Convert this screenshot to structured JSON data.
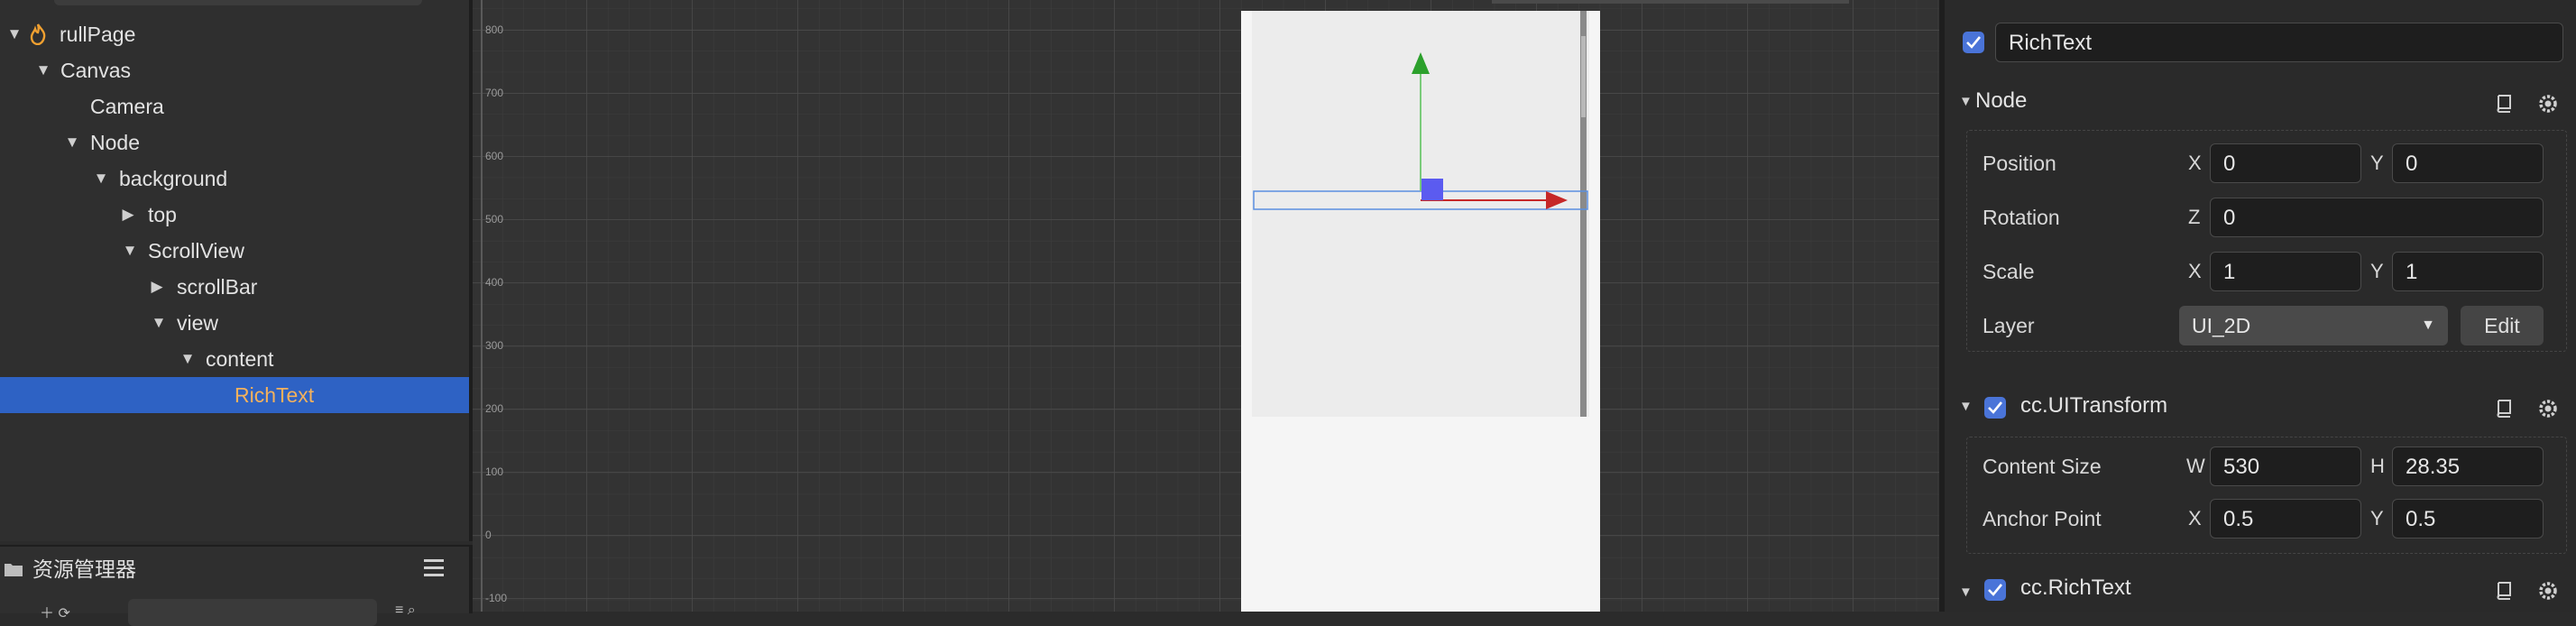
{
  "hierarchy": {
    "root": "rullPage",
    "nodes": {
      "canvas": "Canvas",
      "camera": "Camera",
      "node": "Node",
      "background": "background",
      "top": "top",
      "scrollview": "ScrollView",
      "scrollbar": "scrollBar",
      "view": "view",
      "content": "content",
      "richtext": "RichText"
    }
  },
  "assets": {
    "title": "资源管理器"
  },
  "scene": {
    "ruler_labels": [
      "800",
      "700",
      "600",
      "500",
      "400",
      "300",
      "200",
      "100",
      "0",
      "-100"
    ]
  },
  "inspector": {
    "node_name": "RichText",
    "node_section": {
      "title": "Node",
      "position_label": "Position",
      "position_x": "0",
      "position_y": "0",
      "rotation_label": "Rotation",
      "rotation_z": "0",
      "scale_label": "Scale",
      "scale_x": "1",
      "scale_y": "1",
      "layer_label": "Layer",
      "layer_value": "UI_2D",
      "edit_button": "Edit"
    },
    "uitransform": {
      "title": "cc.UITransform",
      "content_size_label": "Content Size",
      "width": "530",
      "height": "28.35",
      "anchor_label": "Anchor Point",
      "anchor_x": "0.5",
      "anchor_y": "0.5"
    },
    "richtext": {
      "title": "cc.RichText"
    },
    "axis": {
      "x": "X",
      "y": "Y",
      "z": "Z",
      "w": "W",
      "h": "H"
    }
  },
  "colors": {
    "selection": "#2e62c4",
    "selected_text": "#f3b15d",
    "checkbox": "#4a74d8",
    "gizmo_x": "#c62828",
    "gizmo_y": "#2ca02c",
    "gizmo_center": "#5b5bf0"
  }
}
